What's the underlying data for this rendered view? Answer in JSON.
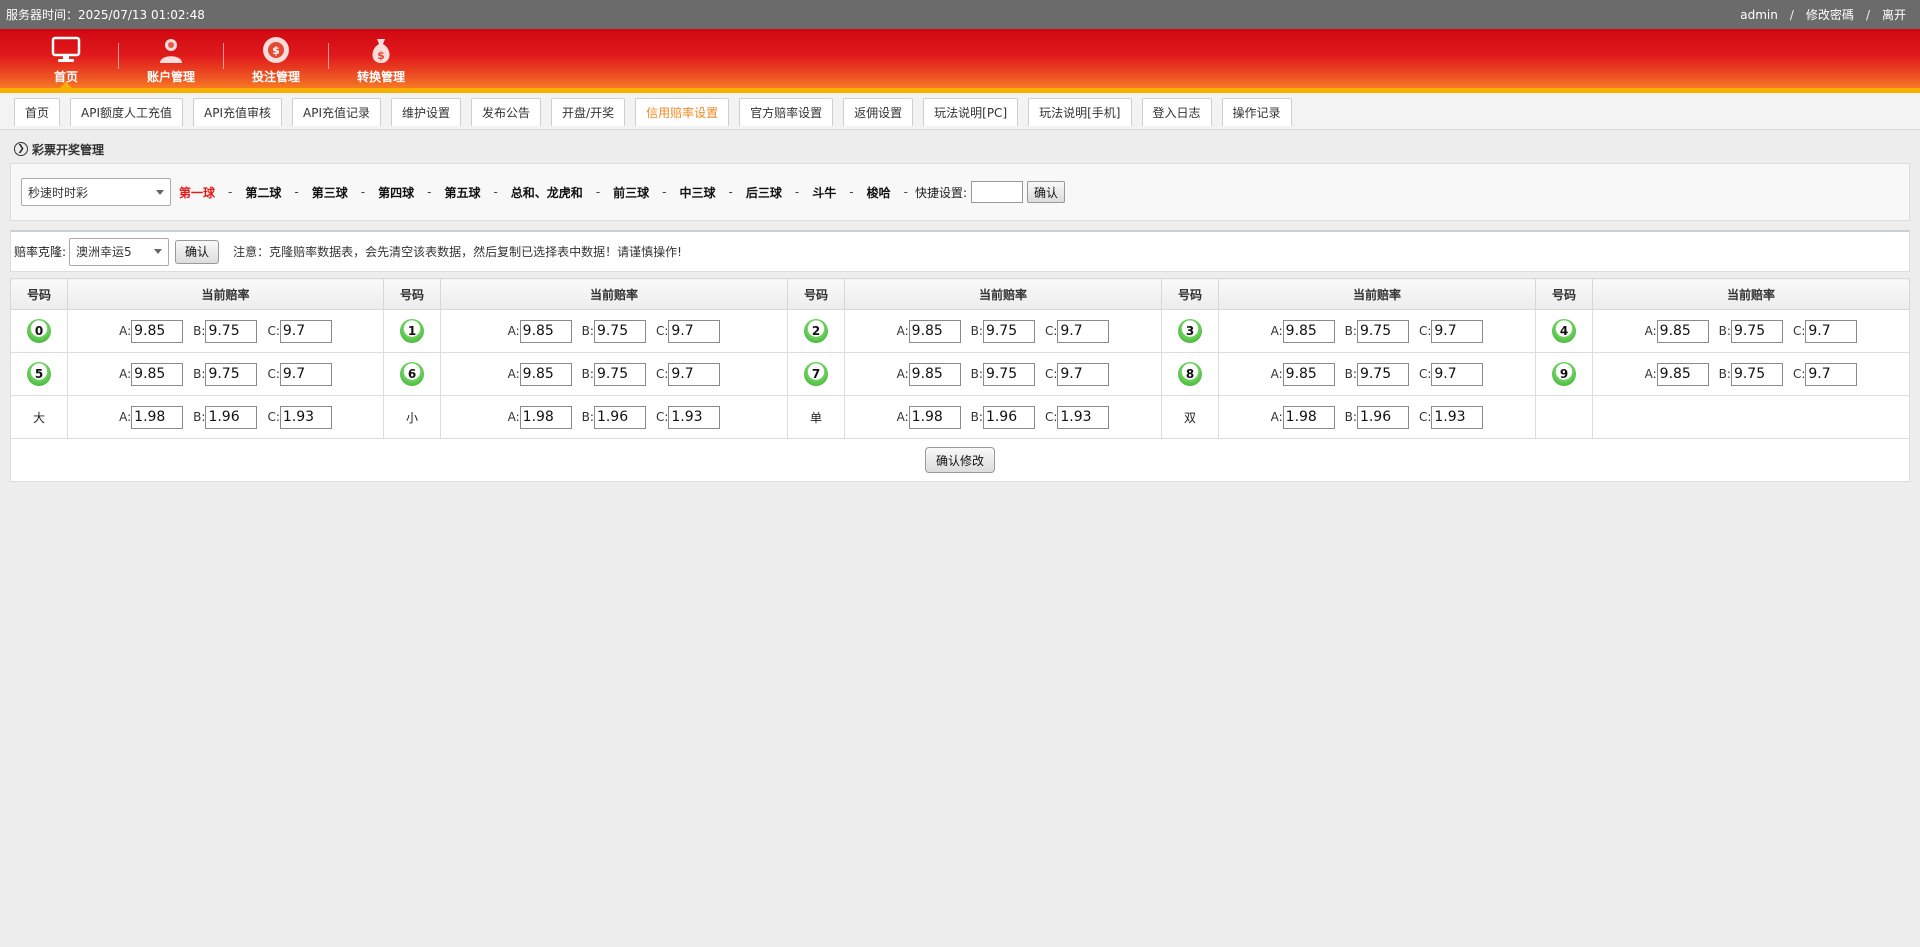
{
  "topbar": {
    "server_time": "服务器时间：2025/07/13 01:02:48",
    "user": "admin",
    "sep1": "/",
    "change_pwd": "修改密碼",
    "sep2": "/",
    "logout": "离开"
  },
  "nav": [
    {
      "label": "首页",
      "icon": "monitor-icon"
    },
    {
      "label": "账户管理",
      "icon": "user-icon"
    },
    {
      "label": "投注管理",
      "icon": "chip-icon"
    },
    {
      "label": "转换管理",
      "icon": "money-bag-icon"
    }
  ],
  "tabs": [
    "首页",
    "API额度人工充值",
    "API充值审核",
    "API充值记录",
    "维护设置",
    "发布公告",
    "开盘/开奖",
    "信用赔率设置",
    "官方赔率设置",
    "返佣设置",
    "玩法说明[PC]",
    "玩法说明[手机]",
    "登入日志",
    "操作记录"
  ],
  "active_tab": 7,
  "section_title": "彩票开奖管理",
  "lottery_select": "秒速时时彩",
  "balls": [
    "第一球",
    "第二球",
    "第三球",
    "第四球",
    "第五球",
    "总和、龙虎和",
    "前三球",
    "中三球",
    "后三球",
    "斗牛",
    "梭哈"
  ],
  "ball_dash": "-",
  "active_ball": 0,
  "quick_label": "快捷设置:",
  "quick_value": "",
  "confirm": "确认",
  "clone": {
    "label": "赔率克隆:",
    "select": "澳洲幸运5",
    "button": "确认",
    "note": "注意：克隆赔率数据表，会先清空该表数据，然后复制已选择表中数据！请谨慎操作!"
  },
  "table": {
    "h_num": "号码",
    "h_rate": "当前赔率",
    "rate_keys": [
      "A:",
      "B:",
      "C:"
    ],
    "rows": [
      [
        {
          "n": "0",
          "ball": true,
          "a": "9.85",
          "b": "9.75",
          "c": "9.7"
        },
        {
          "n": "1",
          "ball": true,
          "a": "9.85",
          "b": "9.75",
          "c": "9.7"
        },
        {
          "n": "2",
          "ball": true,
          "a": "9.85",
          "b": "9.75",
          "c": "9.7"
        },
        {
          "n": "3",
          "ball": true,
          "a": "9.85",
          "b": "9.75",
          "c": "9.7"
        },
        {
          "n": "4",
          "ball": true,
          "a": "9.85",
          "b": "9.75",
          "c": "9.7"
        }
      ],
      [
        {
          "n": "5",
          "ball": true,
          "a": "9.85",
          "b": "9.75",
          "c": "9.7"
        },
        {
          "n": "6",
          "ball": true,
          "a": "9.85",
          "b": "9.75",
          "c": "9.7"
        },
        {
          "n": "7",
          "ball": true,
          "a": "9.85",
          "b": "9.75",
          "c": "9.7"
        },
        {
          "n": "8",
          "ball": true,
          "a": "9.85",
          "b": "9.75",
          "c": "9.7"
        },
        {
          "n": "9",
          "ball": true,
          "a": "9.85",
          "b": "9.75",
          "c": "9.7"
        }
      ],
      [
        {
          "n": "大",
          "ball": false,
          "a": "1.98",
          "b": "1.96",
          "c": "1.93"
        },
        {
          "n": "小",
          "ball": false,
          "a": "1.98",
          "b": "1.96",
          "c": "1.93"
        },
        {
          "n": "单",
          "ball": false,
          "a": "1.98",
          "b": "1.96",
          "c": "1.93"
        },
        {
          "n": "双",
          "ball": false,
          "a": "1.98",
          "b": "1.96",
          "c": "1.93"
        },
        null
      ]
    ],
    "submit": "确认修改"
  }
}
